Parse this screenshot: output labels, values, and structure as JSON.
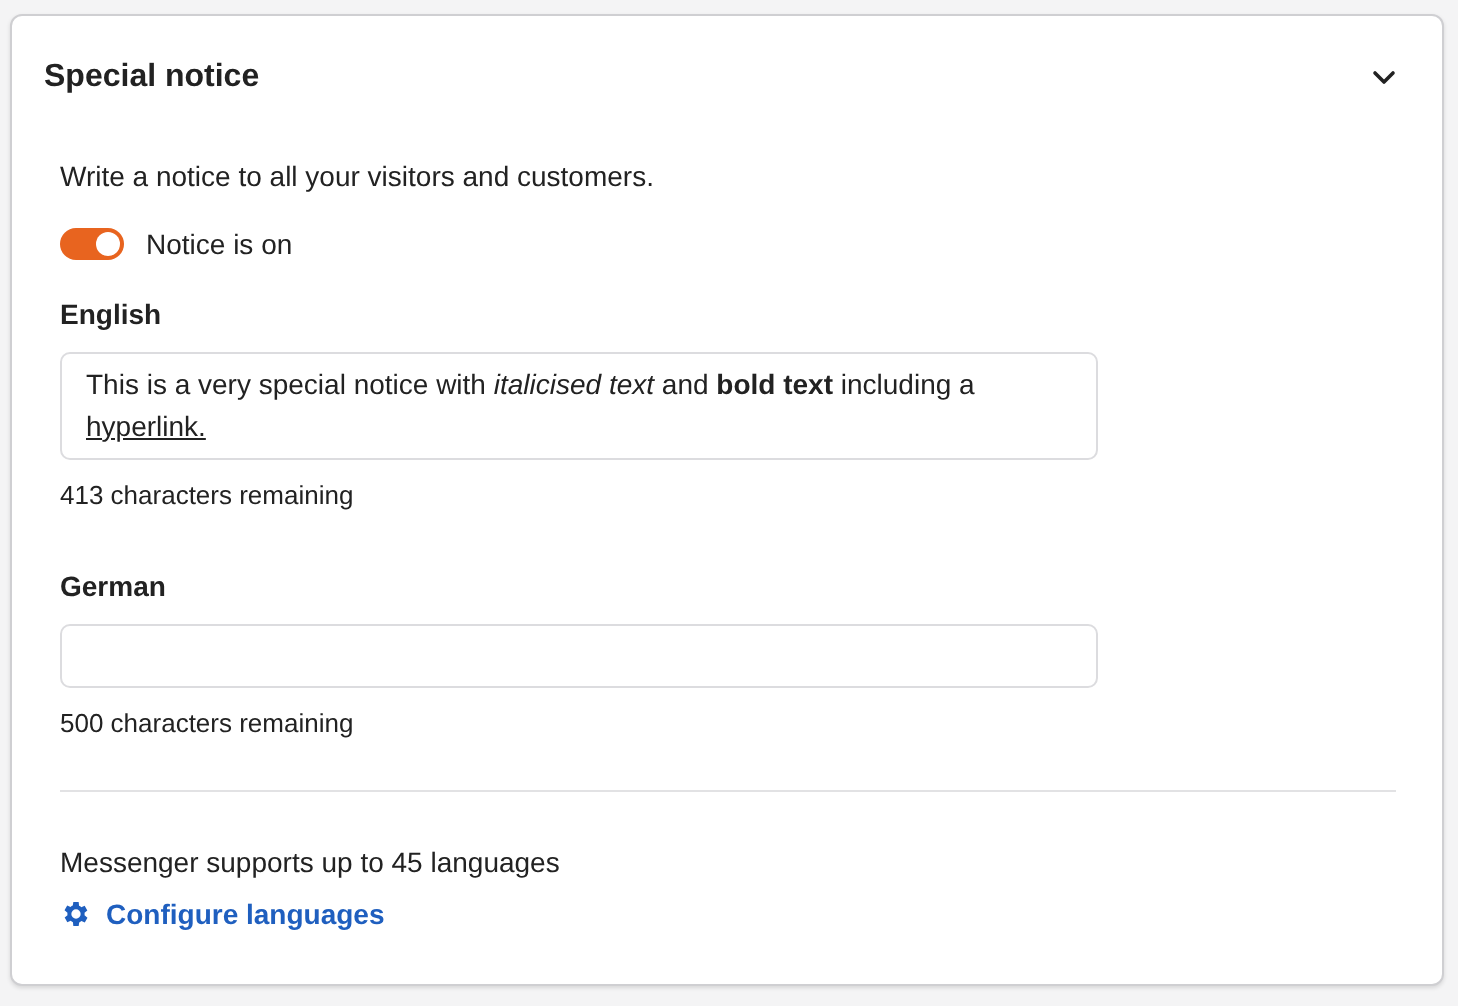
{
  "panel": {
    "title": "Special notice",
    "expanded": true,
    "description": "Write a notice to all your visitors and customers.",
    "toggle": {
      "label": "Notice is on",
      "on": true
    },
    "languages": [
      {
        "label": "English",
        "value": "This is a very special notice with *italicised text* and **bold text** including a",
        "link": "hyperlink.",
        "remaining": "413 characters remaining"
      },
      {
        "label": "German",
        "remaining": "500 characters remaining"
      }
    ],
    "footer": {
      "text": "Messenger supports up to 45 languages",
      "link": "Configure languages"
    }
  }
}
